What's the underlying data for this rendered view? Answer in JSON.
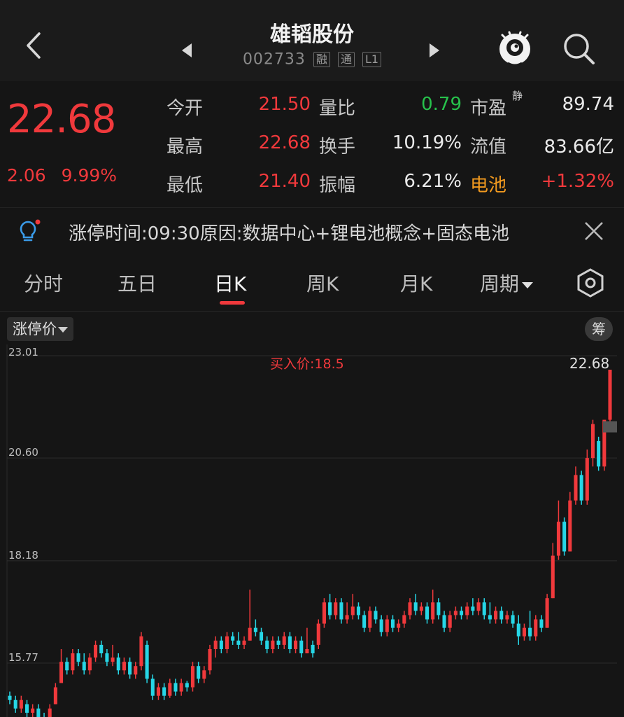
{
  "header": {
    "title": "雄韬股份",
    "code": "002733",
    "tags": [
      "融",
      "通",
      "L1"
    ]
  },
  "quote": {
    "price": "22.68",
    "change": "2.06",
    "change_pct": "9.99%",
    "rows": [
      {
        "l1": "今开",
        "v1": "21.50",
        "l2": "量比",
        "v2": "0.79",
        "l3": "市盈",
        "sup": "静",
        "v3": "89.74"
      },
      {
        "l1": "最高",
        "v1": "22.68",
        "l2": "换手",
        "v2": "10.19%",
        "l3": "流值",
        "v3": "83.66亿"
      },
      {
        "l1": "最低",
        "v1": "21.40",
        "l2": "振幅",
        "v2": "6.21%",
        "l3": "电池",
        "v3": "+1.32%"
      }
    ]
  },
  "news": {
    "text": "涨停时间:09:30原因:数据中心+锂电池概念+固态电池"
  },
  "tabs": [
    "分时",
    "五日",
    "日K",
    "周K",
    "月K",
    "周期"
  ],
  "active_tab": "日K",
  "chart_toolbar": {
    "indicator": "涨停价",
    "chip": "筹"
  },
  "colors": {
    "up": "#f0393c",
    "down": "#26d6e6",
    "green_value": "#27c24c",
    "orange": "#f29a1f"
  },
  "chart_data": {
    "type": "candlestick",
    "y_ticks": [
      "23.01",
      "20.60",
      "18.18",
      "15.77"
    ],
    "ylim": [
      14.5,
      23.01
    ],
    "annotation": "买入价:18.5",
    "last_price_label": "22.68",
    "candles": [
      [
        15.0,
        14.9,
        15.1,
        14.8
      ],
      [
        14.9,
        14.7,
        15.0,
        14.6
      ],
      [
        14.7,
        14.9,
        15.0,
        14.6
      ],
      [
        14.8,
        14.6,
        14.9,
        14.5
      ],
      [
        14.6,
        14.7,
        14.8,
        14.4
      ],
      [
        14.7,
        14.5,
        14.8,
        14.4
      ],
      [
        14.5,
        14.4,
        14.6,
        14.3
      ],
      [
        14.4,
        14.7,
        14.8,
        14.35
      ],
      [
        14.8,
        15.2,
        15.3,
        14.8
      ],
      [
        15.3,
        15.8,
        16.1,
        15.3
      ],
      [
        15.8,
        15.6,
        15.9,
        15.5
      ],
      [
        15.6,
        16.0,
        16.1,
        15.5
      ],
      [
        16.0,
        15.8,
        16.1,
        15.7
      ],
      [
        15.8,
        15.6,
        16.0,
        15.5
      ],
      [
        15.6,
        15.9,
        16.0,
        15.5
      ],
      [
        15.9,
        16.2,
        16.3,
        15.8
      ],
      [
        16.2,
        16.0,
        16.3,
        15.9
      ],
      [
        16.0,
        15.8,
        16.1,
        15.7
      ],
      [
        15.8,
        15.9,
        16.2,
        15.7
      ],
      [
        15.9,
        15.6,
        16.0,
        15.5
      ],
      [
        15.6,
        15.8,
        15.9,
        15.5
      ],
      [
        15.8,
        15.5,
        15.9,
        15.4
      ],
      [
        15.5,
        15.7,
        15.8,
        15.4
      ],
      [
        15.7,
        16.4,
        16.5,
        15.6
      ],
      [
        16.2,
        15.4,
        16.3,
        15.3
      ],
      [
        15.4,
        15.0,
        15.5,
        14.9
      ],
      [
        15.0,
        15.2,
        15.3,
        14.9
      ],
      [
        15.2,
        15.0,
        15.3,
        14.9
      ],
      [
        15.0,
        15.3,
        15.4,
        14.95
      ],
      [
        15.3,
        15.1,
        15.4,
        15.0
      ],
      [
        15.1,
        15.3,
        15.4,
        15.0
      ],
      [
        15.3,
        15.2,
        15.35,
        15.1
      ],
      [
        15.2,
        15.7,
        15.8,
        15.1
      ],
      [
        15.7,
        15.4,
        15.8,
        15.3
      ],
      [
        15.4,
        15.6,
        15.7,
        15.3
      ],
      [
        15.6,
        16.1,
        16.2,
        15.5
      ],
      [
        16.1,
        16.3,
        16.4,
        15.9
      ],
      [
        16.3,
        16.1,
        16.4,
        16.0
      ],
      [
        16.1,
        16.4,
        16.5,
        16.0
      ],
      [
        16.4,
        16.3,
        16.5,
        16.2
      ],
      [
        16.3,
        16.2,
        16.5,
        16.1
      ],
      [
        16.2,
        16.3,
        16.4,
        16.1
      ],
      [
        16.3,
        16.6,
        17.5,
        16.3
      ],
      [
        16.6,
        16.5,
        16.8,
        16.4
      ],
      [
        16.5,
        16.3,
        16.6,
        16.2
      ],
      [
        16.3,
        16.1,
        16.4,
        16.0
      ],
      [
        16.1,
        16.3,
        16.4,
        16.0
      ],
      [
        16.3,
        16.2,
        16.4,
        16.1
      ],
      [
        16.2,
        16.4,
        16.5,
        16.1
      ],
      [
        16.4,
        16.1,
        16.5,
        16.0
      ],
      [
        16.1,
        16.3,
        16.4,
        16.0
      ],
      [
        16.3,
        16.0,
        16.4,
        15.9
      ],
      [
        16.0,
        16.1,
        16.6,
        16.0
      ],
      [
        16.2,
        16.0,
        16.3,
        15.9
      ],
      [
        16.2,
        16.7,
        16.8,
        16.1
      ],
      [
        16.7,
        17.2,
        17.3,
        16.6
      ],
      [
        17.2,
        16.9,
        17.4,
        16.8
      ],
      [
        16.9,
        17.2,
        17.3,
        16.8
      ],
      [
        17.2,
        16.8,
        17.3,
        16.7
      ],
      [
        16.8,
        16.9,
        17.2,
        16.7
      ],
      [
        16.9,
        17.1,
        17.4,
        16.8
      ],
      [
        17.1,
        16.9,
        17.2,
        16.8
      ],
      [
        16.9,
        16.6,
        17.0,
        16.5
      ],
      [
        16.6,
        17.0,
        17.1,
        16.5
      ],
      [
        17.0,
        16.8,
        17.1,
        16.7
      ],
      [
        16.8,
        16.5,
        16.9,
        16.4
      ],
      [
        16.5,
        16.8,
        16.9,
        16.4
      ],
      [
        16.8,
        16.6,
        16.9,
        16.5
      ],
      [
        16.6,
        16.7,
        16.8,
        16.5
      ],
      [
        16.7,
        16.9,
        17.0,
        16.6
      ],
      [
        16.9,
        17.2,
        17.3,
        16.8
      ],
      [
        17.2,
        17.0,
        17.4,
        16.9
      ],
      [
        17.0,
        17.1,
        17.2,
        16.9
      ],
      [
        17.1,
        16.8,
        17.2,
        16.7
      ],
      [
        16.8,
        17.2,
        17.5,
        16.7
      ],
      [
        17.2,
        16.9,
        17.3,
        16.8
      ],
      [
        16.9,
        16.6,
        17.0,
        16.5
      ],
      [
        16.6,
        16.9,
        17.0,
        16.5
      ],
      [
        16.9,
        17.0,
        17.1,
        16.8
      ],
      [
        17.0,
        16.9,
        17.1,
        16.8
      ],
      [
        16.9,
        17.1,
        17.2,
        16.8
      ],
      [
        17.1,
        17.0,
        17.3,
        16.9
      ],
      [
        17.0,
        17.2,
        17.3,
        16.9
      ],
      [
        17.2,
        16.9,
        17.3,
        16.8
      ],
      [
        16.9,
        16.8,
        17.2,
        16.7
      ],
      [
        16.8,
        17.0,
        17.1,
        16.7
      ],
      [
        17.0,
        16.8,
        17.1,
        16.7
      ],
      [
        16.8,
        16.9,
        17.0,
        16.7
      ],
      [
        16.9,
        16.7,
        17.0,
        16.6
      ],
      [
        16.7,
        16.4,
        16.9,
        16.2
      ],
      [
        16.4,
        16.6,
        16.7,
        16.3
      ],
      [
        16.6,
        16.4,
        17.0,
        16.3
      ],
      [
        16.4,
        16.8,
        16.9,
        16.3
      ],
      [
        16.8,
        16.6,
        16.9,
        16.5
      ],
      [
        16.6,
        17.3,
        17.4,
        16.6
      ],
      [
        17.3,
        18.3,
        18.6,
        17.3
      ],
      [
        18.3,
        19.1,
        19.6,
        18.2
      ],
      [
        19.1,
        18.4,
        19.2,
        18.3
      ],
      [
        18.4,
        19.6,
        19.8,
        18.4
      ],
      [
        19.6,
        20.2,
        20.4,
        19.5
      ],
      [
        20.2,
        19.6,
        20.3,
        19.5
      ],
      [
        19.6,
        20.6,
        20.8,
        19.5
      ],
      [
        20.6,
        21.4,
        21.5,
        20.4
      ],
      [
        21.0,
        20.4,
        21.1,
        20.3
      ],
      [
        20.4,
        21.5,
        21.5,
        20.3
      ],
      [
        21.5,
        22.68,
        22.68,
        21.4
      ]
    ]
  }
}
